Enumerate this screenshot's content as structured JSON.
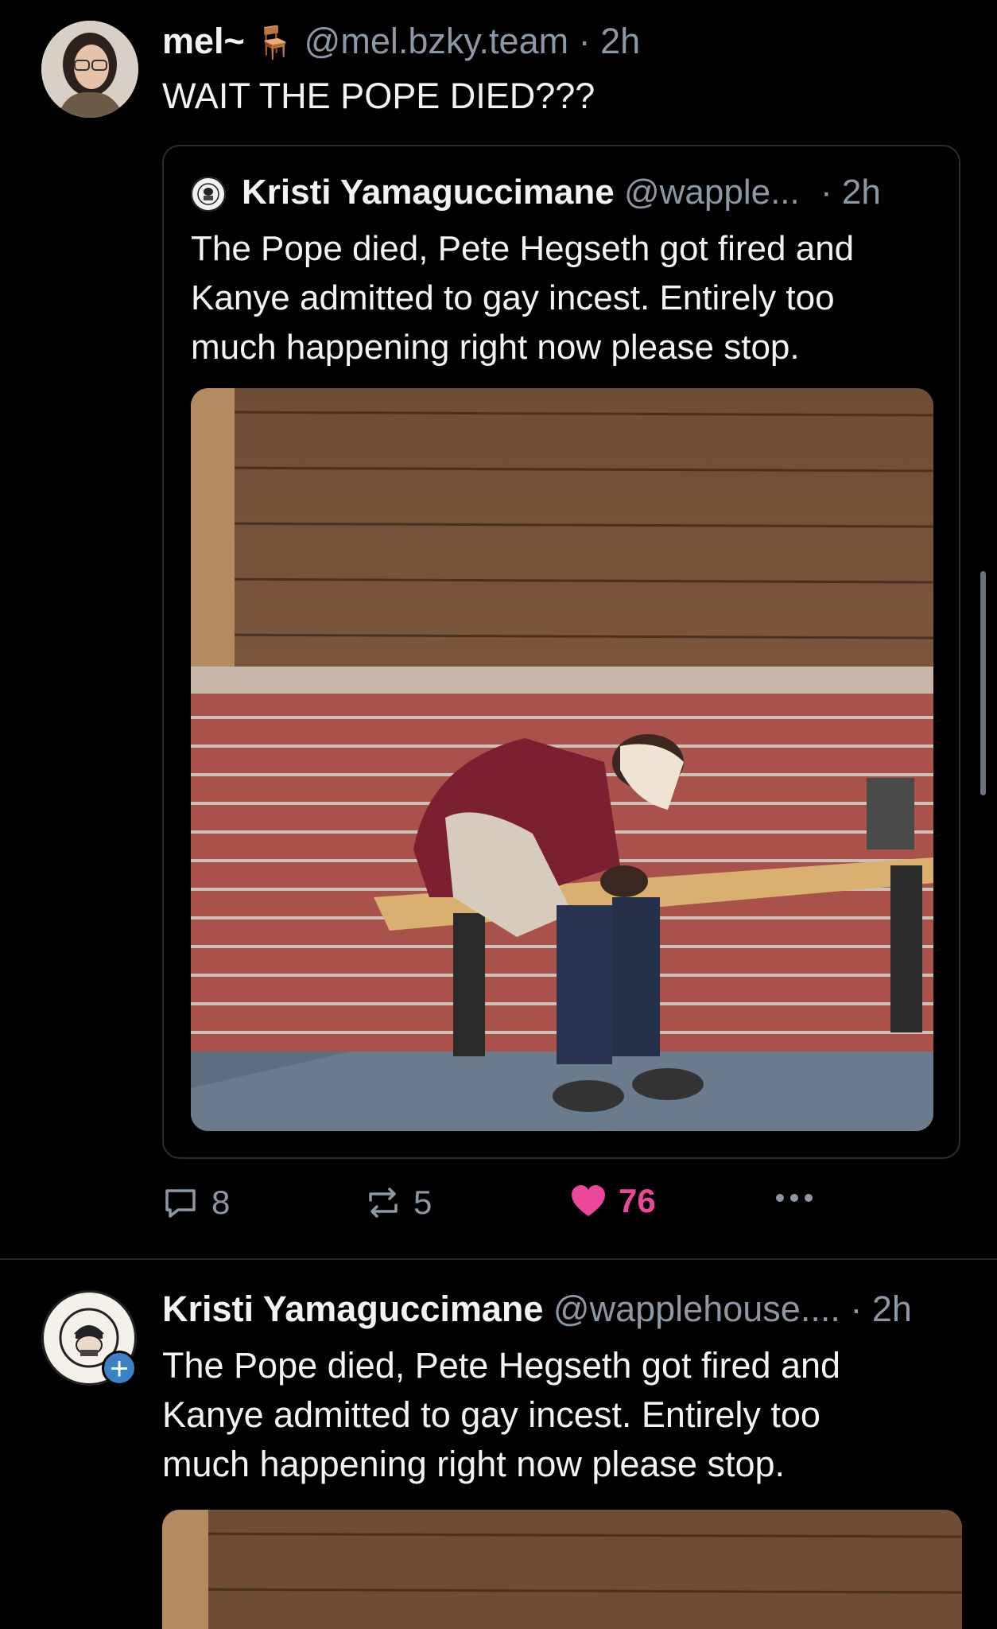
{
  "post": {
    "display_name": "mel~",
    "chair_emoji": "🪑",
    "handle": "@mel.bzky.team",
    "time": "· 2h",
    "text": "WAIT THE POPE DIED???",
    "quote": {
      "display_name": "Kristi Yamaguccimane",
      "handle": "@wapple...",
      "time": "· 2h",
      "text_line1": "The Pope died, Pete Hegseth got fired and",
      "text_line2": "Kanye admitted to gay incest. Entirely too",
      "text_line3": "much happening right now please stop."
    },
    "actions": {
      "replies": "8",
      "reposts": "5",
      "likes": "76",
      "like_color": "#ec4899",
      "more_icon": "ellipsis-icon"
    }
  },
  "post2": {
    "display_name": "Kristi Yamaguccimane",
    "handle": "@wapplehouse....",
    "time": "· 2h",
    "text_line1": "The Pope died, Pete Hegseth got fired and",
    "text_line2": "Kanye admitted to gay incest. Entirely too",
    "text_line3": "much happening right now please stop.",
    "follow_icon": "plus-icon"
  },
  "colors": {
    "background": "#000000",
    "text": "#f1f3f5",
    "muted": "#8b98a5",
    "accent": "#3b82c4"
  }
}
